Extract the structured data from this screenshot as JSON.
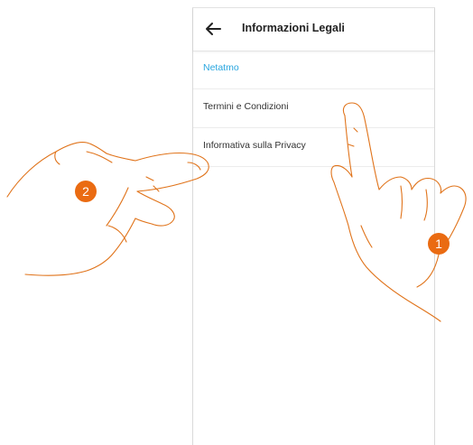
{
  "header": {
    "back_icon": "arrow-left-icon",
    "title": "Informazioni Legali"
  },
  "menu": {
    "items": [
      {
        "label": "Netatmo",
        "selected": true
      },
      {
        "label": "Termini e Condizioni",
        "selected": false
      },
      {
        "label": "Informativa sulla Privacy",
        "selected": false
      }
    ]
  },
  "callouts": {
    "step_1": "1",
    "step_2": "2",
    "color": "#ea6b12"
  },
  "colors": {
    "accent": "#2aa6df",
    "hand_outline": "#e0731a"
  }
}
